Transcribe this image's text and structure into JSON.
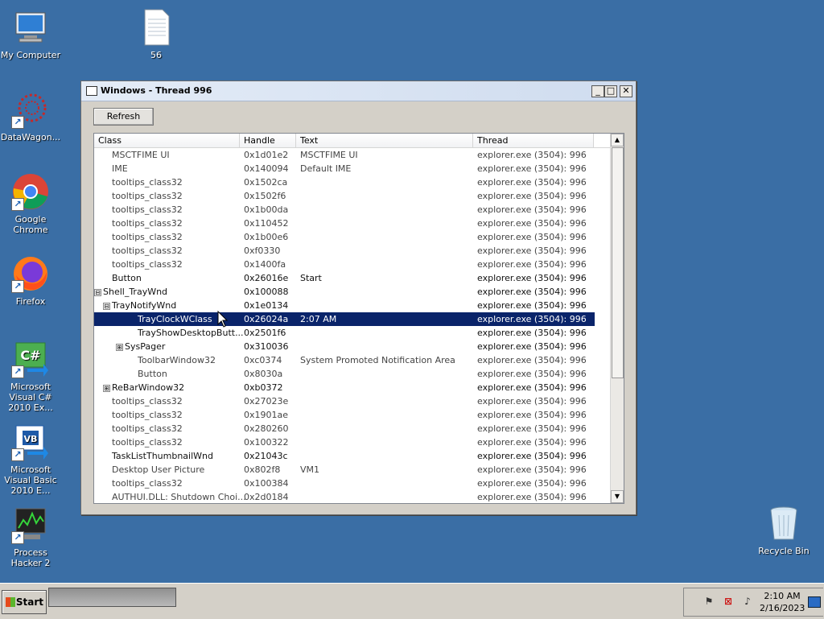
{
  "desktop": {
    "icons": [
      {
        "label": "My Computer",
        "icon": "computer-icon"
      },
      {
        "label": "56",
        "icon": "text-file-icon"
      },
      {
        "label": "DataWagon...",
        "icon": "datawagon-icon"
      },
      {
        "label": "Google Chrome",
        "icon": "chrome-icon"
      },
      {
        "label": "Firefox",
        "icon": "firefox-icon"
      },
      {
        "label": "Microsoft Visual C# 2010 Ex...",
        "icon": "visual-csharp-icon"
      },
      {
        "label": "Microsoft Visual Basic 2010 E...",
        "icon": "visual-basic-icon"
      },
      {
        "label": "Process Hacker 2",
        "icon": "process-hacker-icon"
      },
      {
        "label": "Recycle Bin",
        "icon": "recycle-bin-icon"
      }
    ]
  },
  "window": {
    "title": "Windows - Thread 996",
    "buttons": {
      "minimize": "_",
      "maximize": "□",
      "close": "✕"
    },
    "refresh_label": "Refresh",
    "columns": [
      "Class",
      "Handle",
      "Text",
      "Thread"
    ],
    "rows": [
      {
        "indent": 1,
        "toggle": "",
        "class": "MSCTFIME UI",
        "handle": "0x1d01e2",
        "text": "MSCTFIME UI",
        "thread": "explorer.exe (3504): 996"
      },
      {
        "indent": 1,
        "toggle": "",
        "class": "IME",
        "handle": "0x140094",
        "text": "Default IME",
        "thread": "explorer.exe (3504): 996"
      },
      {
        "indent": 1,
        "toggle": "",
        "class": "tooltips_class32",
        "handle": "0x1502ca",
        "text": "",
        "thread": "explorer.exe (3504): 996"
      },
      {
        "indent": 1,
        "toggle": "",
        "class": "tooltips_class32",
        "handle": "0x1502f6",
        "text": "",
        "thread": "explorer.exe (3504): 996"
      },
      {
        "indent": 1,
        "toggle": "",
        "class": "tooltips_class32",
        "handle": "0x1b00da",
        "text": "",
        "thread": "explorer.exe (3504): 996"
      },
      {
        "indent": 1,
        "toggle": "",
        "class": "tooltips_class32",
        "handle": "0x110452",
        "text": "",
        "thread": "explorer.exe (3504): 996"
      },
      {
        "indent": 1,
        "toggle": "",
        "class": "tooltips_class32",
        "handle": "0x1b00e6",
        "text": "",
        "thread": "explorer.exe (3504): 996"
      },
      {
        "indent": 1,
        "toggle": "",
        "class": "tooltips_class32",
        "handle": "0xf0330",
        "text": "",
        "thread": "explorer.exe (3504): 996"
      },
      {
        "indent": 1,
        "toggle": "",
        "class": "tooltips_class32",
        "handle": "0x1400fa",
        "text": "",
        "thread": "explorer.exe (3504): 996"
      },
      {
        "indent": 1,
        "toggle": "",
        "class": "Button",
        "handle": "0x26016e",
        "text": "Start",
        "thread": "explorer.exe (3504): 996",
        "dark": true
      },
      {
        "indent": 0,
        "toggle": "⊟",
        "class": "Shell_TrayWnd",
        "handle": "0x100088",
        "text": "",
        "thread": "explorer.exe (3504): 996",
        "dark": true
      },
      {
        "indent": 1,
        "toggle": "⊟",
        "class": "TrayNotifyWnd",
        "handle": "0x1e0134",
        "text": "",
        "thread": "explorer.exe (3504): 996",
        "dark": true
      },
      {
        "indent": 3,
        "toggle": "",
        "class": "TrayClockWClass",
        "handle": "0x26024a",
        "text": "2:07 AM",
        "thread": "explorer.exe (3504): 996",
        "selected": true
      },
      {
        "indent": 3,
        "toggle": "",
        "class": "TrayShowDesktopButt...",
        "handle": "0x2501f6",
        "text": "",
        "thread": "explorer.exe (3504): 996",
        "dark": true
      },
      {
        "indent": 2,
        "toggle": "⊞",
        "class": "SysPager",
        "handle": "0x310036",
        "text": "",
        "thread": "explorer.exe (3504): 996",
        "dark": true
      },
      {
        "indent": 3,
        "toggle": "",
        "class": "ToolbarWindow32",
        "handle": "0xc0374",
        "text": "System Promoted Notification Area",
        "thread": "explorer.exe (3504): 996"
      },
      {
        "indent": 3,
        "toggle": "",
        "class": "Button",
        "handle": "0x8030a",
        "text": "",
        "thread": "explorer.exe (3504): 996"
      },
      {
        "indent": 1,
        "toggle": "⊞",
        "class": "ReBarWindow32",
        "handle": "0xb0372",
        "text": "",
        "thread": "explorer.exe (3504): 996",
        "dark": true
      },
      {
        "indent": 1,
        "toggle": "",
        "class": "tooltips_class32",
        "handle": "0x27023e",
        "text": "",
        "thread": "explorer.exe (3504): 996"
      },
      {
        "indent": 1,
        "toggle": "",
        "class": "tooltips_class32",
        "handle": "0x1901ae",
        "text": "",
        "thread": "explorer.exe (3504): 996"
      },
      {
        "indent": 1,
        "toggle": "",
        "class": "tooltips_class32",
        "handle": "0x280260",
        "text": "",
        "thread": "explorer.exe (3504): 996"
      },
      {
        "indent": 1,
        "toggle": "",
        "class": "tooltips_class32",
        "handle": "0x100322",
        "text": "",
        "thread": "explorer.exe (3504): 996"
      },
      {
        "indent": 1,
        "toggle": "",
        "class": "TaskListThumbnailWnd",
        "handle": "0x21043c",
        "text": "",
        "thread": "explorer.exe (3504): 996",
        "dark": true
      },
      {
        "indent": 1,
        "toggle": "",
        "class": "Desktop User Picture",
        "handle": "0x802f8",
        "text": "VM1",
        "thread": "explorer.exe (3504): 996"
      },
      {
        "indent": 1,
        "toggle": "",
        "class": "tooltips_class32",
        "handle": "0x100384",
        "text": "",
        "thread": "explorer.exe (3504): 996"
      },
      {
        "indent": 1,
        "toggle": "",
        "class": "AUTHUI.DLL: Shutdown Choi...",
        "handle": "0x2d0184",
        "text": "",
        "thread": "explorer.exe (3504): 996"
      }
    ]
  },
  "taskbar": {
    "start_label": "Start",
    "clock_time": "2:10 AM",
    "clock_date": "2/16/2023"
  }
}
